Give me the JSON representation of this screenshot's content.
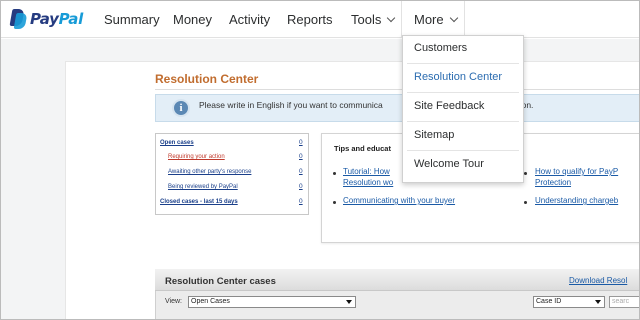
{
  "brand": {
    "pay": "Pay",
    "pal": "Pal"
  },
  "nav": {
    "summary": "Summary",
    "money": "Money",
    "activity": "Activity",
    "reports": "Reports",
    "tools": "Tools",
    "more": "More"
  },
  "more_menu": {
    "items": [
      "Customers",
      "Resolution Center",
      "Site Feedback",
      "Sitemap",
      "Welcome Tour"
    ],
    "active": "Resolution Center"
  },
  "page": {
    "title": "Resolution Center",
    "info_left": "Please write in English if you want to communica",
    "info_right": "olution.",
    "info_icon": "info-icon"
  },
  "cases": {
    "open_cases": "Open cases",
    "requiring_action": "Requiring your action",
    "awaiting_response": "Awaiting other party's response",
    "being_reviewed": "Being reviewed by PayPal",
    "closed_cases": "Closed cases - last 15 days",
    "counts": [
      "0",
      "0",
      "0",
      "0",
      "0"
    ]
  },
  "tips": {
    "title": "Tips and educat",
    "link1_line1": "Tutorial: How",
    "link1_line2": "Resolution wo",
    "link2": "Communicating with your buyer",
    "link3_line1": "How to qualify for PayP",
    "link3_line2": "Protection",
    "link4": "Understanding chargeb"
  },
  "cases_table": {
    "title": "Resolution Center cases",
    "download": "Download Resol",
    "view_label": "View:",
    "view_value": "Open Cases",
    "filter_value": "Case ID",
    "search_placeholder": "searc"
  },
  "colors": {
    "accent_title": "#c16d2f",
    "link": "#1a5aa6",
    "brand_dark": "#253b80",
    "brand_light": "#179bd7"
  }
}
